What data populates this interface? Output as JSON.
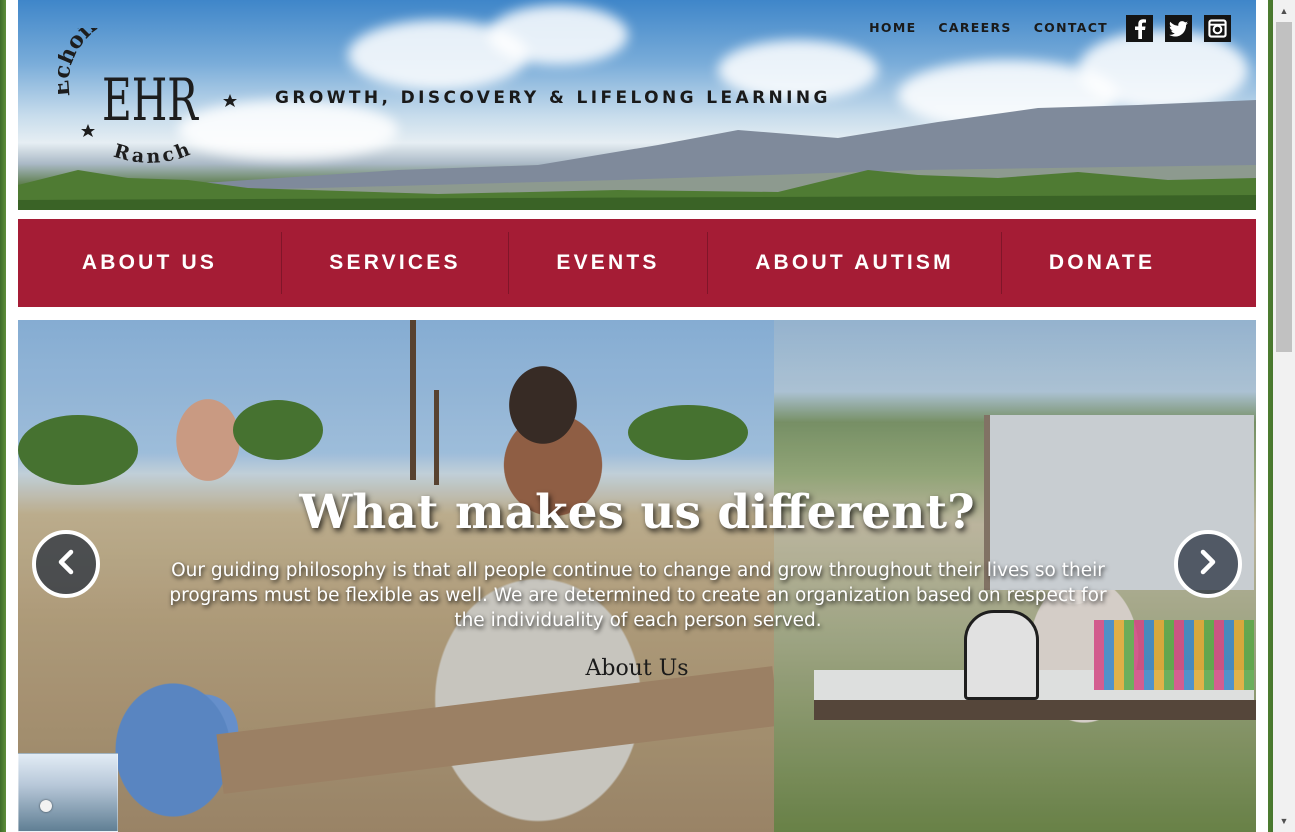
{
  "header": {
    "logo": {
      "arc_text": "Echoing Hope",
      "monogram": "EHR",
      "bottom_text": "Ranch"
    },
    "tagline": "GROWTH, DISCOVERY & LIFELONG LEARNING",
    "top_links": [
      "HOME",
      "CAREERS",
      "CONTACT"
    ],
    "social_icons": [
      "facebook-icon",
      "twitter-icon",
      "instagram-icon"
    ]
  },
  "main_nav": {
    "items": [
      "ABOUT US",
      "SERVICES",
      "EVENTS",
      "ABOUT AUTISM",
      "DONATE"
    ]
  },
  "hero": {
    "title": "What makes us different?",
    "text": "Our guiding philosophy is that all people continue to change and grow throughout their lives so their programs must be flexible as well. We are determined to create an organization based on respect for the individuality of each person served.",
    "link": "About Us",
    "prev_icon": "chevron-left-icon",
    "next_icon": "chevron-right-icon"
  },
  "colors": {
    "nav_bg": "#a51c35",
    "nav_text": "#ffffff",
    "header_text": "#1a1a1a"
  }
}
